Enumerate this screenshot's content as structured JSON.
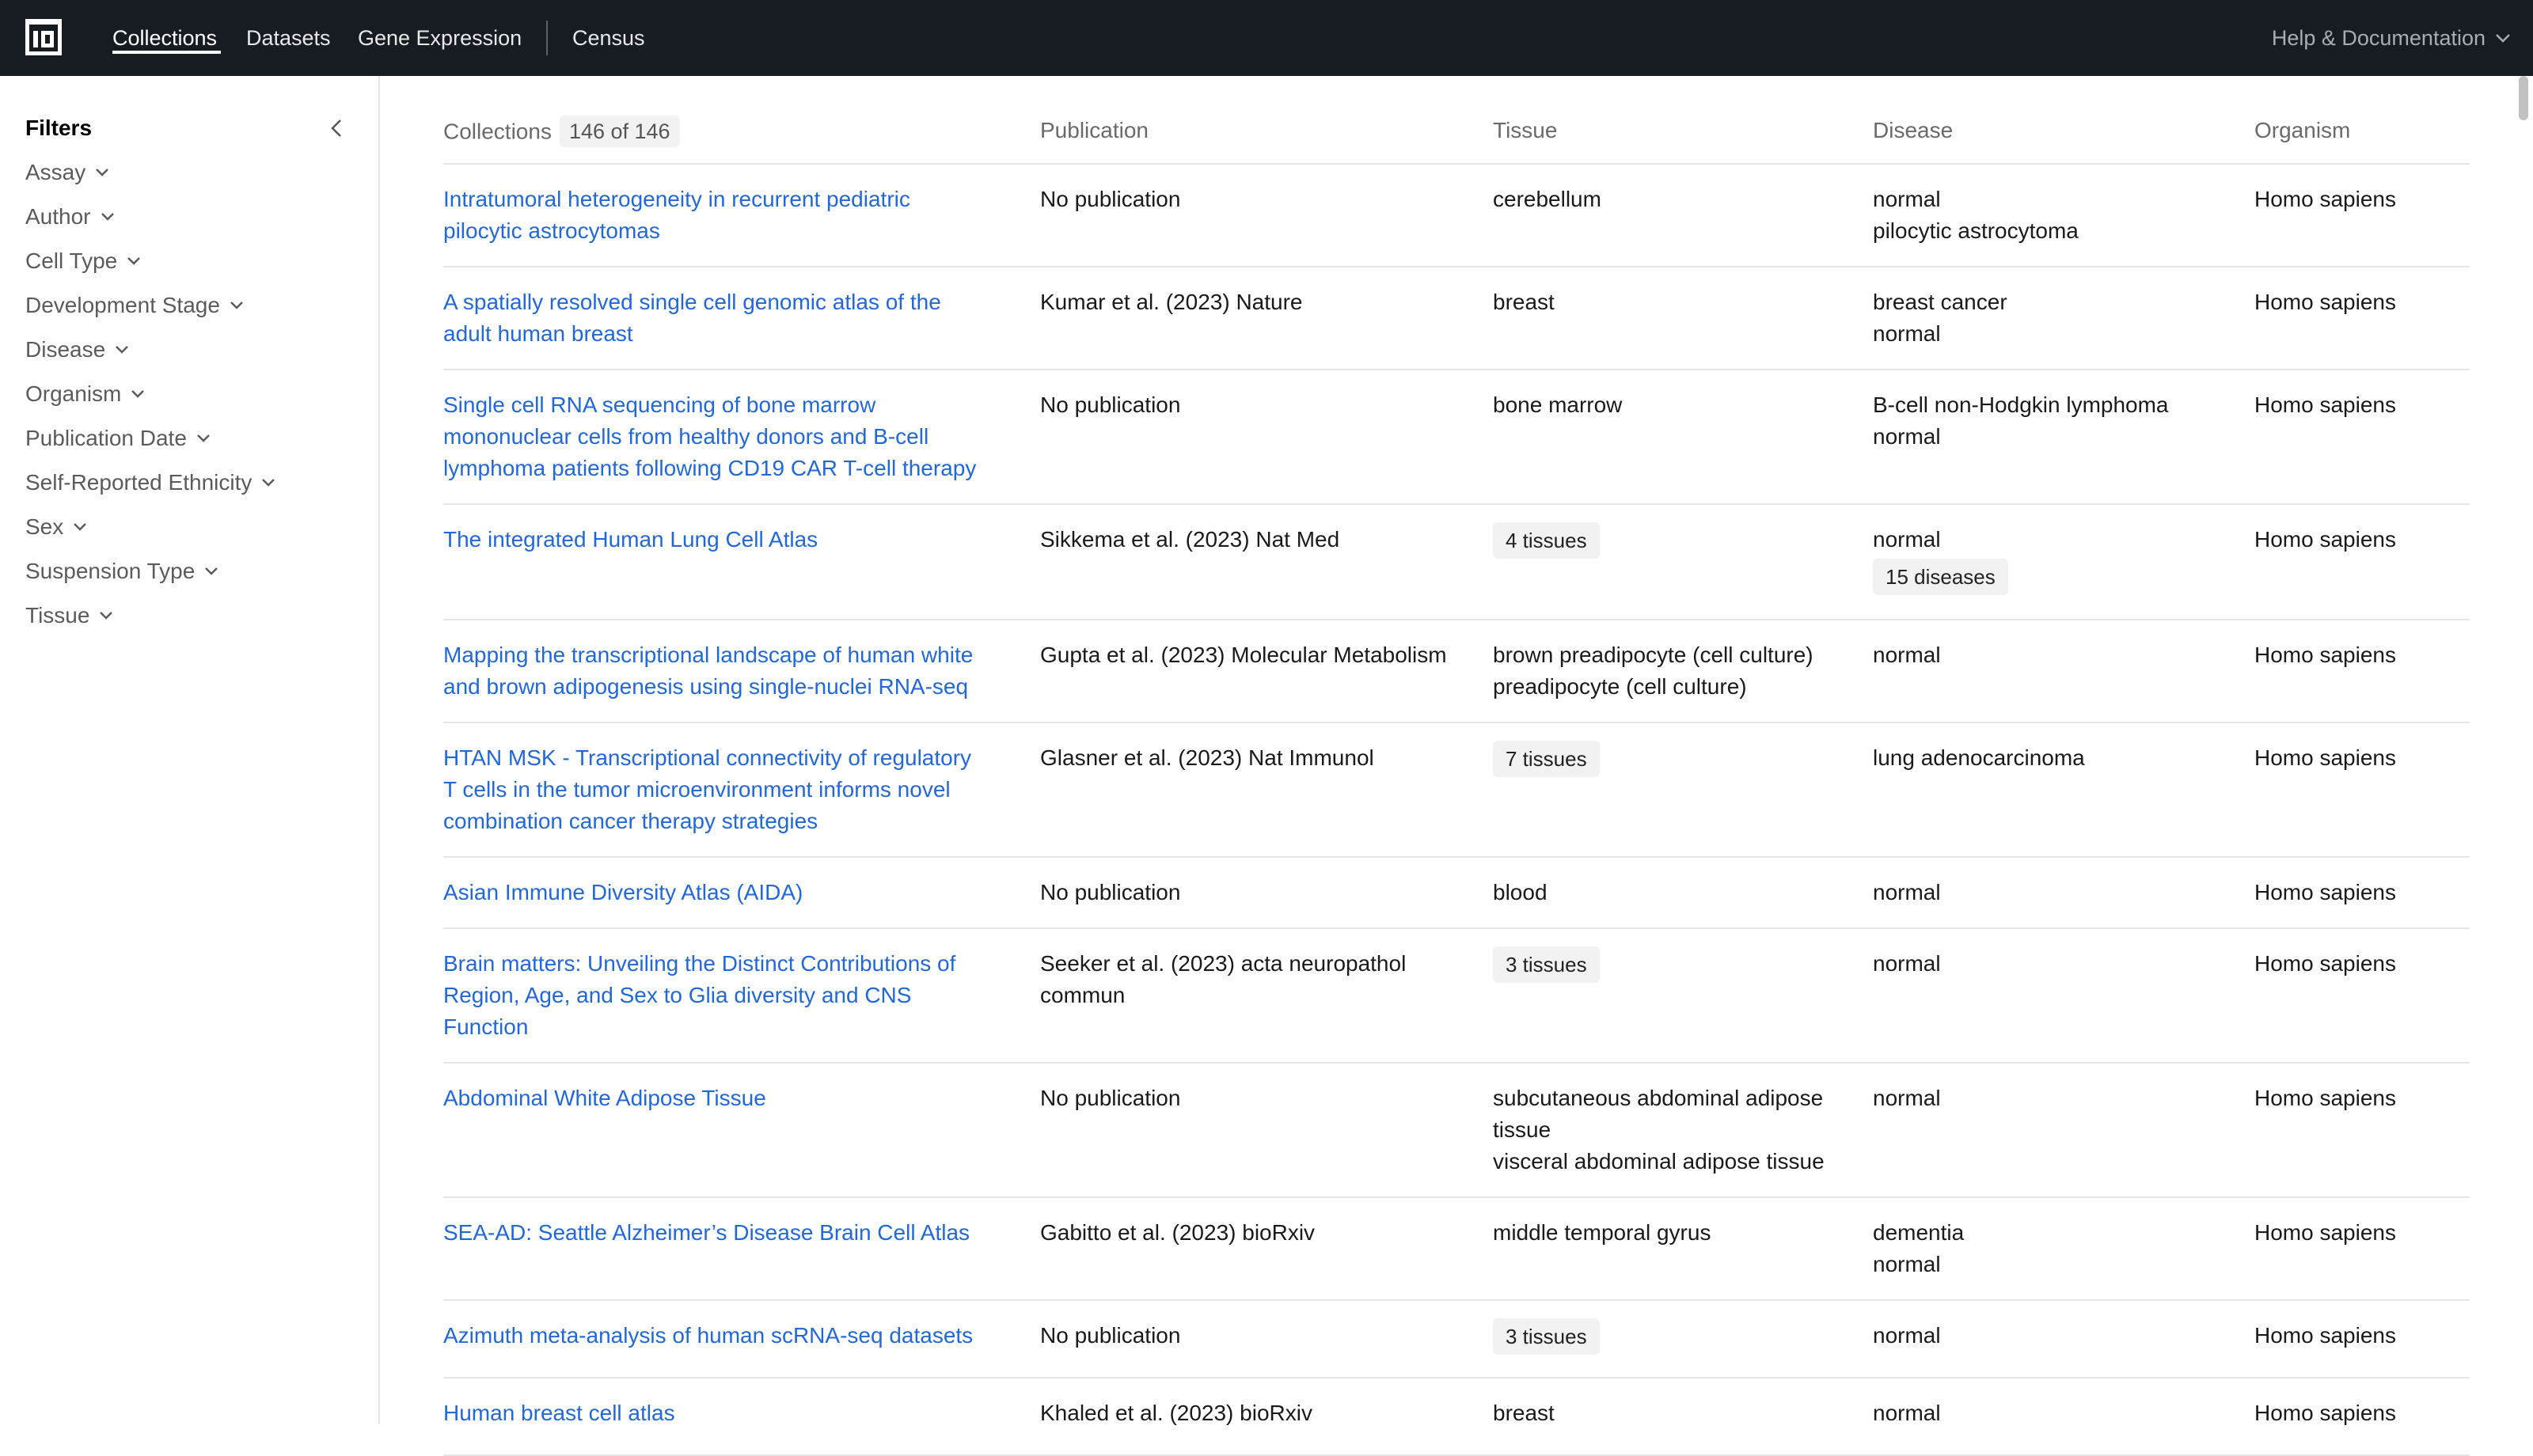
{
  "nav": {
    "items": [
      {
        "label": "Collections"
      },
      {
        "label": "Datasets"
      },
      {
        "label": "Gene Expression"
      },
      {
        "label": "Census"
      }
    ],
    "help": "Help & Documentation"
  },
  "sidebar": {
    "title": "Filters",
    "filters": [
      "Assay",
      "Author",
      "Cell Type",
      "Development Stage",
      "Disease",
      "Organism",
      "Publication Date",
      "Self-Reported Ethnicity",
      "Sex",
      "Suspension Type",
      "Tissue"
    ]
  },
  "table": {
    "headers": {
      "collections": "Collections",
      "count": "146 of 146",
      "publication": "Publication",
      "tissue": "Tissue",
      "disease": "Disease",
      "organism": "Organism"
    },
    "rows": [
      {
        "title": [
          "Intratumoral heterogeneity in recurrent pediatric",
          "pilocytic astrocytomas"
        ],
        "publication": [
          "No publication"
        ],
        "tissue": [
          "cerebellum"
        ],
        "disease": [
          "normal",
          "pilocytic astrocytoma"
        ],
        "organism": "Homo sapiens"
      },
      {
        "title": [
          "A spatially resolved single cell genomic atlas of the",
          "adult human breast"
        ],
        "publication": [
          "Kumar et al. (2023) Nature"
        ],
        "tissue": [
          "breast"
        ],
        "disease": [
          "breast cancer",
          "normal"
        ],
        "organism": "Homo sapiens"
      },
      {
        "title": [
          "Single cell RNA sequencing of bone marrow",
          "mononuclear cells from healthy donors and B-cell",
          "lymphoma patients following CD19 CAR T-cell therapy"
        ],
        "publication": [
          "No publication"
        ],
        "tissue": [
          "bone marrow"
        ],
        "disease": [
          "B-cell non-Hodgkin lymphoma",
          "normal"
        ],
        "organism": "Homo sapiens"
      },
      {
        "title": [
          "The integrated Human Lung Cell Atlas"
        ],
        "publication": [
          "Sikkema et al. (2023) Nat Med"
        ],
        "tissue_pill": "4 tissues",
        "disease": [
          "normal"
        ],
        "disease_pill": "15 diseases",
        "organism": "Homo sapiens"
      },
      {
        "title": [
          "Mapping the transcriptional landscape of human white",
          "and brown adipogenesis using single-nuclei RNA-seq"
        ],
        "publication": [
          "Gupta et al. (2023) Molecular Metabolism"
        ],
        "tissue": [
          "brown preadipocyte (cell culture)",
          "preadipocyte (cell culture)"
        ],
        "disease": [
          "normal"
        ],
        "organism": "Homo sapiens"
      },
      {
        "title": [
          "HTAN MSK - Transcriptional connectivity of regulatory",
          "T cells in the tumor microenvironment informs novel",
          "combination cancer therapy strategies"
        ],
        "publication": [
          "Glasner et al. (2023) Nat Immunol"
        ],
        "tissue_pill": "7 tissues",
        "disease": [
          "lung adenocarcinoma"
        ],
        "organism": "Homo sapiens"
      },
      {
        "title": [
          "Asian Immune Diversity Atlas (AIDA)"
        ],
        "publication": [
          "No publication"
        ],
        "tissue": [
          "blood"
        ],
        "disease": [
          "normal"
        ],
        "organism": "Homo sapiens"
      },
      {
        "title": [
          "Brain matters: Unveiling the Distinct Contributions of",
          "Region, Age, and Sex to Glia diversity and CNS",
          "Function"
        ],
        "publication": [
          "Seeker et al. (2023) acta neuropathol",
          "commun"
        ],
        "tissue_pill": "3 tissues",
        "disease": [
          "normal"
        ],
        "organism": "Homo sapiens"
      },
      {
        "title": [
          "Abdominal White Adipose Tissue"
        ],
        "publication": [
          "No publication"
        ],
        "tissue": [
          "subcutaneous abdominal adipose",
          "tissue",
          "visceral abdominal adipose tissue"
        ],
        "disease": [
          "normal"
        ],
        "organism": "Homo sapiens"
      },
      {
        "title": [
          "SEA-AD: Seattle Alzheimer’s Disease Brain Cell Atlas"
        ],
        "publication": [
          "Gabitto et al. (2023) bioRxiv"
        ],
        "tissue": [
          "middle temporal gyrus"
        ],
        "disease": [
          "dementia",
          "normal"
        ],
        "organism": "Homo sapiens"
      },
      {
        "title": [
          "Azimuth meta-analysis of human scRNA-seq datasets"
        ],
        "publication": [
          "No publication"
        ],
        "tissue_pill": "3 tissues",
        "disease": [
          "normal"
        ],
        "organism": "Homo sapiens"
      },
      {
        "title": [
          "Human breast cell atlas"
        ],
        "publication": [
          "Khaled et al. (2023) bioRxiv"
        ],
        "tissue": [
          "breast"
        ],
        "disease": [
          "normal"
        ],
        "organism": "Homo sapiens"
      }
    ]
  },
  "colors": {
    "nav_bg": "#171b22",
    "link": "#2268d6",
    "muted_text": "#6a6a6a",
    "pill_bg": "#f2f2f2",
    "border": "#e6e6e6"
  },
  "icons": [
    "app-logo-icon",
    "chevron-down-icon",
    "chevron-left-icon"
  ]
}
